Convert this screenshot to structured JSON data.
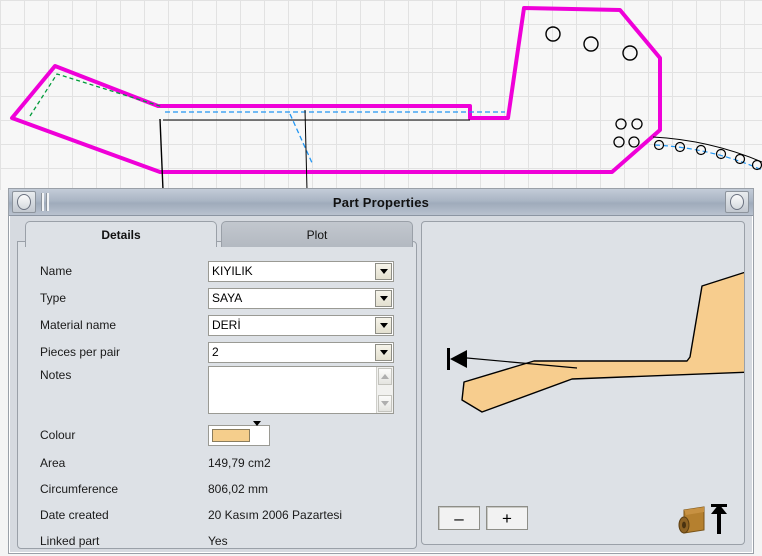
{
  "canvas": {
    "name": "cad-drawing-canvas",
    "outline_color": "#ef00d8",
    "construction_green": "#009b3a",
    "construction_blue": "#2196f3",
    "grid_color": "#e2e2e2",
    "background": "#f7f7f7"
  },
  "dialog": {
    "title": "Part Properties",
    "titlebar_left_button": "system-menu",
    "titlebar_right_button": "close-roll"
  },
  "tabs": [
    {
      "label": "Details",
      "active": true
    },
    {
      "label": "Plot",
      "active": false
    }
  ],
  "fields": {
    "name": {
      "label": "Name",
      "value": "KIYILIK"
    },
    "type": {
      "label": "Type",
      "value": "SAYA"
    },
    "material_name": {
      "label": "Material name",
      "value": "DERİ"
    },
    "pieces_per_pair": {
      "label": "Pieces per pair",
      "value": "2"
    },
    "notes": {
      "label": "Notes",
      "value": ""
    },
    "colour": {
      "label": "Colour",
      "value": "#f5ce8c"
    },
    "area": {
      "label": "Area",
      "value": "149,79 cm2"
    },
    "circumference": {
      "label": "Circumference",
      "value": "806,02 mm"
    },
    "date_created": {
      "label": "Date created",
      "value": "20 Kasım 2006 Pazartesi"
    },
    "linked_part": {
      "label": "Linked part",
      "value": "Yes"
    }
  },
  "preview": {
    "shape_fill": "#f7cd8e",
    "shape_stroke": "#000000",
    "zoom_out_label": "–",
    "zoom_in_label": "+",
    "grain_icon": "leather-roll-icon",
    "direction_icon": "grain-direction-arrow-icon"
  }
}
